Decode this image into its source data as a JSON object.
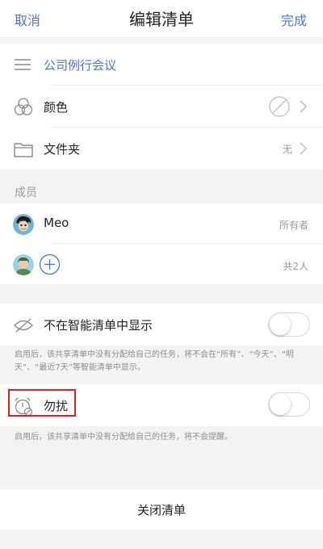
{
  "nav": {
    "cancel": "取消",
    "title": "编辑清单",
    "done": "完成"
  },
  "list": {
    "name": "公司例行会议"
  },
  "settings": {
    "color_label": "颜色",
    "folder_label": "文件夹",
    "folder_value": "无"
  },
  "members": {
    "header": "成员",
    "items": [
      {
        "name": "Meo",
        "role": "所有者"
      }
    ],
    "total": "共2人"
  },
  "smart_list": {
    "label": "不在智能清单中显示",
    "enabled": false,
    "note": "启用后，该共享清单中没有分配给自己的任务，将不会在“所有”、“今天”、“明天”、“最近7天”等智能清单中显示。"
  },
  "dnd": {
    "label": "勿扰",
    "enabled": false,
    "note": "启用后，该共享清单中没有分配给自己的任务，将不会提醒。"
  },
  "close_list": {
    "label": "关闭清单"
  },
  "colors": {
    "accent": "#4d74d6",
    "highlight": "#e02020"
  }
}
